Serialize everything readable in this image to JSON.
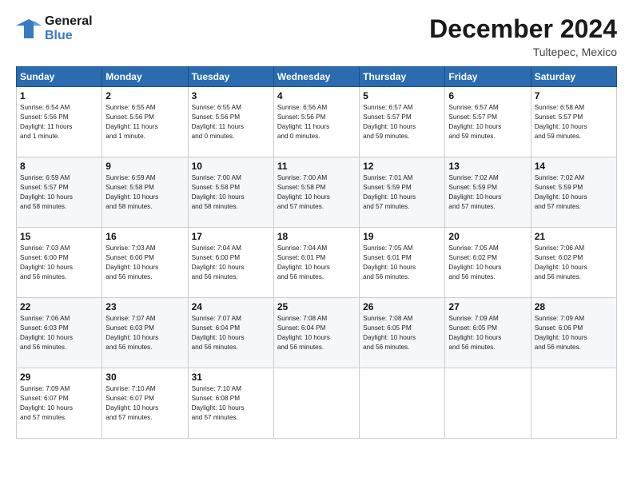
{
  "header": {
    "logo_line1": "General",
    "logo_line2": "Blue",
    "month": "December 2024",
    "location": "Tultepec, Mexico"
  },
  "days_of_week": [
    "Sunday",
    "Monday",
    "Tuesday",
    "Wednesday",
    "Thursday",
    "Friday",
    "Saturday"
  ],
  "weeks": [
    [
      {
        "day": "1",
        "info": "Sunrise: 6:54 AM\nSunset: 5:56 PM\nDaylight: 11 hours\nand 1 minute."
      },
      {
        "day": "2",
        "info": "Sunrise: 6:55 AM\nSunset: 5:56 PM\nDaylight: 11 hours\nand 1 minute."
      },
      {
        "day": "3",
        "info": "Sunrise: 6:55 AM\nSunset: 5:56 PM\nDaylight: 11 hours\nand 0 minutes."
      },
      {
        "day": "4",
        "info": "Sunrise: 6:56 AM\nSunset: 5:56 PM\nDaylight: 11 hours\nand 0 minutes."
      },
      {
        "day": "5",
        "info": "Sunrise: 6:57 AM\nSunset: 5:57 PM\nDaylight: 10 hours\nand 59 minutes."
      },
      {
        "day": "6",
        "info": "Sunrise: 6:57 AM\nSunset: 5:57 PM\nDaylight: 10 hours\nand 59 minutes."
      },
      {
        "day": "7",
        "info": "Sunrise: 6:58 AM\nSunset: 5:57 PM\nDaylight: 10 hours\nand 59 minutes."
      }
    ],
    [
      {
        "day": "8",
        "info": "Sunrise: 6:59 AM\nSunset: 5:57 PM\nDaylight: 10 hours\nand 58 minutes."
      },
      {
        "day": "9",
        "info": "Sunrise: 6:59 AM\nSunset: 5:58 PM\nDaylight: 10 hours\nand 58 minutes."
      },
      {
        "day": "10",
        "info": "Sunrise: 7:00 AM\nSunset: 5:58 PM\nDaylight: 10 hours\nand 58 minutes."
      },
      {
        "day": "11",
        "info": "Sunrise: 7:00 AM\nSunset: 5:58 PM\nDaylight: 10 hours\nand 57 minutes."
      },
      {
        "day": "12",
        "info": "Sunrise: 7:01 AM\nSunset: 5:59 PM\nDaylight: 10 hours\nand 57 minutes."
      },
      {
        "day": "13",
        "info": "Sunrise: 7:02 AM\nSunset: 5:59 PM\nDaylight: 10 hours\nand 57 minutes."
      },
      {
        "day": "14",
        "info": "Sunrise: 7:02 AM\nSunset: 5:59 PM\nDaylight: 10 hours\nand 57 minutes."
      }
    ],
    [
      {
        "day": "15",
        "info": "Sunrise: 7:03 AM\nSunset: 6:00 PM\nDaylight: 10 hours\nand 56 minutes."
      },
      {
        "day": "16",
        "info": "Sunrise: 7:03 AM\nSunset: 6:00 PM\nDaylight: 10 hours\nand 56 minutes."
      },
      {
        "day": "17",
        "info": "Sunrise: 7:04 AM\nSunset: 6:00 PM\nDaylight: 10 hours\nand 56 minutes."
      },
      {
        "day": "18",
        "info": "Sunrise: 7:04 AM\nSunset: 6:01 PM\nDaylight: 10 hours\nand 56 minutes."
      },
      {
        "day": "19",
        "info": "Sunrise: 7:05 AM\nSunset: 6:01 PM\nDaylight: 10 hours\nand 56 minutes."
      },
      {
        "day": "20",
        "info": "Sunrise: 7:05 AM\nSunset: 6:02 PM\nDaylight: 10 hours\nand 56 minutes."
      },
      {
        "day": "21",
        "info": "Sunrise: 7:06 AM\nSunset: 6:02 PM\nDaylight: 10 hours\nand 56 minutes."
      }
    ],
    [
      {
        "day": "22",
        "info": "Sunrise: 7:06 AM\nSunset: 6:03 PM\nDaylight: 10 hours\nand 56 minutes."
      },
      {
        "day": "23",
        "info": "Sunrise: 7:07 AM\nSunset: 6:03 PM\nDaylight: 10 hours\nand 56 minutes."
      },
      {
        "day": "24",
        "info": "Sunrise: 7:07 AM\nSunset: 6:04 PM\nDaylight: 10 hours\nand 56 minutes."
      },
      {
        "day": "25",
        "info": "Sunrise: 7:08 AM\nSunset: 6:04 PM\nDaylight: 10 hours\nand 56 minutes."
      },
      {
        "day": "26",
        "info": "Sunrise: 7:08 AM\nSunset: 6:05 PM\nDaylight: 10 hours\nand 56 minutes."
      },
      {
        "day": "27",
        "info": "Sunrise: 7:09 AM\nSunset: 6:05 PM\nDaylight: 10 hours\nand 56 minutes."
      },
      {
        "day": "28",
        "info": "Sunrise: 7:09 AM\nSunset: 6:06 PM\nDaylight: 10 hours\nand 56 minutes."
      }
    ],
    [
      {
        "day": "29",
        "info": "Sunrise: 7:09 AM\nSunset: 6:07 PM\nDaylight: 10 hours\nand 57 minutes."
      },
      {
        "day": "30",
        "info": "Sunrise: 7:10 AM\nSunset: 6:07 PM\nDaylight: 10 hours\nand 57 minutes."
      },
      {
        "day": "31",
        "info": "Sunrise: 7:10 AM\nSunset: 6:08 PM\nDaylight: 10 hours\nand 57 minutes."
      },
      {
        "day": "",
        "info": ""
      },
      {
        "day": "",
        "info": ""
      },
      {
        "day": "",
        "info": ""
      },
      {
        "day": "",
        "info": ""
      }
    ]
  ]
}
